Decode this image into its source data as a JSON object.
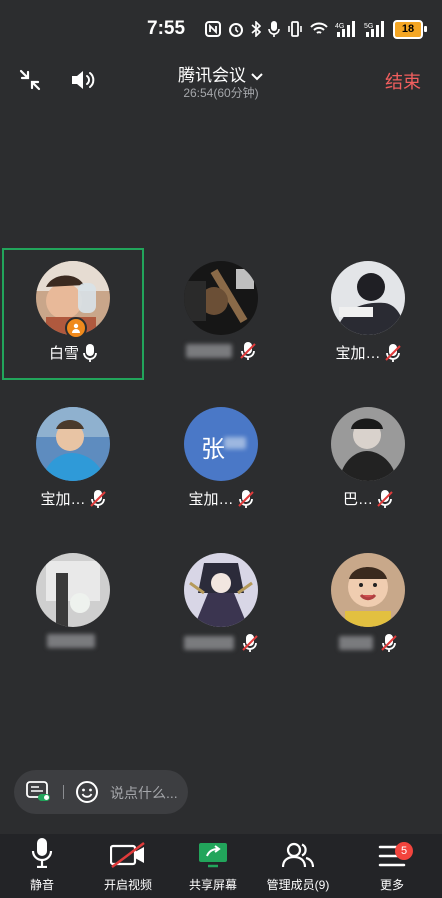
{
  "status_bar": {
    "time": "7:55",
    "battery": "18"
  },
  "header": {
    "title": "腾讯会议",
    "subtitle": "26:54(60分钟)",
    "end_label": "结束"
  },
  "participants": [
    {
      "name": "白雪",
      "mic": "on",
      "host": true,
      "active": true
    },
    {
      "name": "",
      "mic": "muted",
      "name_blurred": true
    },
    {
      "name": "宝加…",
      "mic": "muted"
    },
    {
      "name": "宝加…",
      "mic": "muted"
    },
    {
      "name": "宝加…",
      "mic": "muted",
      "avatar_text": "张"
    },
    {
      "name": "巴…",
      "mic": "muted"
    },
    {
      "name": "",
      "mic": "muted",
      "name_blurred": true
    },
    {
      "name": "",
      "mic": "muted",
      "name_blurred": true
    },
    {
      "name": "",
      "mic": "muted",
      "name_blurred": true
    }
  ],
  "chat": {
    "placeholder": "说点什么..."
  },
  "toolbar": {
    "mute": "静音",
    "video": "开启视频",
    "share": "共享屏幕",
    "members": "管理成员(9)",
    "more": "更多",
    "more_badge": "5"
  },
  "colors": {
    "accent_green": "#22a55b",
    "end_red": "#f15e5e",
    "badge_red": "#f2443d",
    "host_orange": "#f08a1c"
  }
}
